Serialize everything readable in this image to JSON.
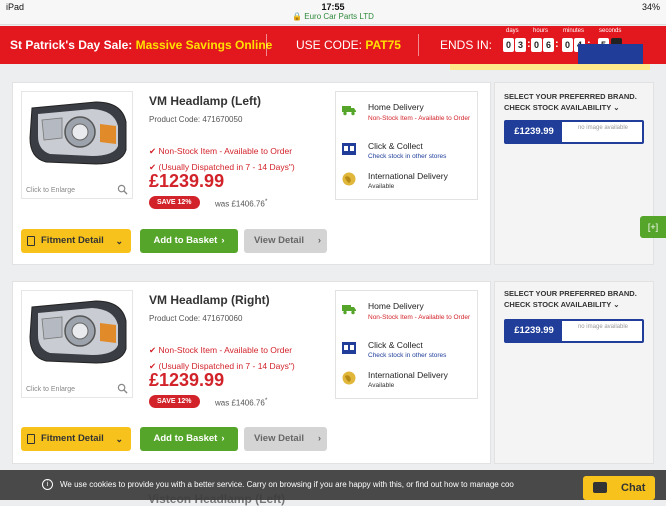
{
  "status_bar": {
    "device": "iPad",
    "time": "17:55",
    "battery": "34%",
    "url": "Euro Car Parts LTD"
  },
  "promo": {
    "sale_prefix": "St Patrick's Day Sale:",
    "sale_highlight": "Massive Savings Online",
    "code_prefix": "USE CODE:",
    "code": "PAT75",
    "ends_label": "ENDS IN:",
    "units": [
      "days",
      "hours",
      "minutes",
      "seconds"
    ],
    "digits": [
      "0",
      "3",
      "0",
      "6",
      "0",
      "4",
      "5",
      ""
    ]
  },
  "products": [
    {
      "name": "VM Headlamp (Left)",
      "code_label": "Product Code: 471670050",
      "stock_lines": [
        "Non-Stock Item - Available to Order",
        "(Usually Dispatched in 7 - 14 Days\")"
      ],
      "price": "£1239.99",
      "save": "SAVE  12%",
      "was": "was  £1406.76",
      "click_enlarge": "Click to Enlarge",
      "delivery": [
        {
          "title": "Home Delivery",
          "sub": "Non-Stock Item - Available to Order",
          "sub_color": "#d2232a",
          "icon": "truck-icon"
        },
        {
          "title": "Click & Collect",
          "sub": "Check stock in other stores",
          "sub_color": "#1f3d99",
          "icon": "store-icon"
        },
        {
          "title": "International Delivery",
          "sub": "Available",
          "sub_color": "#333333",
          "icon": "globe-icon"
        }
      ],
      "buttons": {
        "fitment": "Fitment Detail",
        "basket": "Add to Basket",
        "view": "View Detail"
      },
      "brand_header": [
        "SELECT YOUR PREFERRED BRAND.",
        "CHECK STOCK AVAILABILITY"
      ],
      "brand_price": "£1239.99",
      "no_image": "no image available"
    },
    {
      "name": "VM Headlamp (Right)",
      "code_label": "Product Code: 471670060",
      "stock_lines": [
        "Non-Stock Item - Available to Order",
        "(Usually Dispatched in 7 - 14 Days\")"
      ],
      "price": "£1239.99",
      "save": "SAVE  12%",
      "was": "was  £1406.76",
      "click_enlarge": "Click to Enlarge",
      "delivery": [
        {
          "title": "Home Delivery",
          "sub": "Non-Stock Item - Available to Order",
          "sub_color": "#d2232a",
          "icon": "truck-icon"
        },
        {
          "title": "Click & Collect",
          "sub": "Check stock in other stores",
          "sub_color": "#1f3d99",
          "icon": "store-icon"
        },
        {
          "title": "International Delivery",
          "sub": "Available",
          "sub_color": "#333333",
          "icon": "globe-icon"
        }
      ],
      "buttons": {
        "fitment": "Fitment Detail",
        "basket": "Add to Basket",
        "view": "View Detail"
      },
      "brand_header": [
        "SELECT YOUR PREFERRED BRAND.",
        "CHECK STOCK AVAILABILITY"
      ],
      "brand_price": "£1239.99",
      "no_image": "no image available"
    }
  ],
  "side_tab": "[+]",
  "cookie": {
    "message": "We use cookies to provide you with a better service. Carry on browsing if you are happy with this, or find out how to manage coo"
  },
  "partial_next_item": "Visteon Headlamp (Left)",
  "chat_label": "Chat",
  "colors": {
    "banner_red": "#e3171e",
    "price_red": "#d2232a",
    "brand_blue": "#1f3d99",
    "basket_green": "#55a52a",
    "fitment_yellow": "#f7c21b"
  }
}
